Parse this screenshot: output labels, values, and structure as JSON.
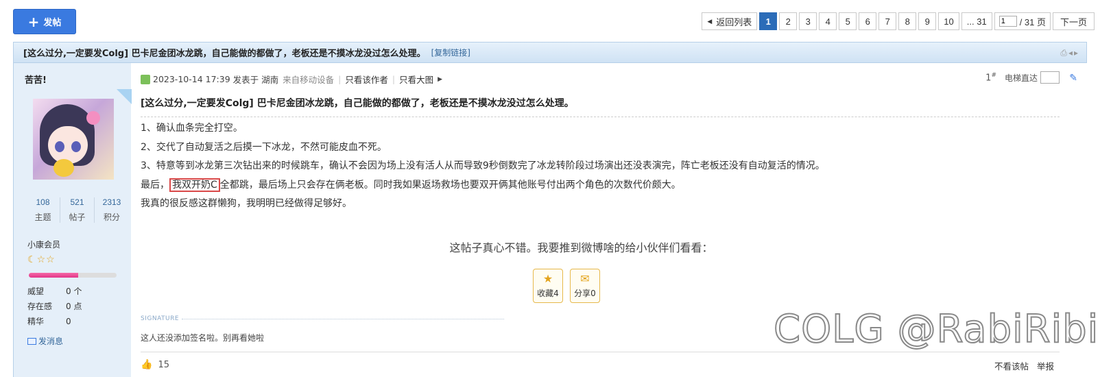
{
  "top_bar": {
    "post_button": "发帖",
    "pager": {
      "back": "返回列表",
      "pages": [
        "1",
        "2",
        "3",
        "4",
        "5",
        "6",
        "7",
        "8",
        "9",
        "10"
      ],
      "last": "... 31",
      "jump_value": "1",
      "jump_total": "/ 31 页",
      "next": "下一页"
    }
  },
  "thread": {
    "title": "[这么过分,一定要发Colg] 巴卡尼金团冰龙跳，自己能做的都做了，老板还是不摸冰龙没过怎么处理。",
    "copy_link": "[复制链接]"
  },
  "user": {
    "name": "苦苦!",
    "stats": [
      {
        "num": "108",
        "label": "主题"
      },
      {
        "num": "521",
        "label": "帖子"
      },
      {
        "num": "2313",
        "label": "积分"
      }
    ],
    "rank": "小康会员",
    "level_progress": 0.56,
    "props": [
      {
        "k": "威望",
        "v": "0 个"
      },
      {
        "k": "存在感",
        "v": "0 点"
      },
      {
        "k": "精华",
        "v": "0"
      }
    ],
    "send_message": "发消息"
  },
  "post": {
    "date": "2023-10-14 17:39",
    "posted_in": "发表于 湖南",
    "device": "来自移动设备",
    "only_author": "只看该作者",
    "only_big": "只看大图",
    "floor": "1",
    "floor_mark": "#",
    "elevator": "电梯直达",
    "title": "[这么过分,一定要发Colg] 巴卡尼金团冰龙跳，自己能做的都做了，老板还是不摸冰龙没过怎么处理。",
    "line1": "1、确认血条完全打空。",
    "line2": "2、交代了自动复活之后摸一下冰龙，不然可能皮血不死。",
    "line3": "3、特意等到冰龙第三次钻出来的时候跳车，确认不会因为场上没有活人从而导致9秒倒数完了冰龙转阶段过场演出还没表演完，阵亡老板还没有自动复活的情况。",
    "line4_pre": "最后，",
    "line4_hl": "我双开奶C",
    "line4_post": "全都跳，最后场上只会存在俩老板。同时我如果返场救场也要双开俩其他账号付出两个角色的次数代价颇大。",
    "line5": "我真的很反感这群懒狗，我明明已经做得足够好。",
    "share_prompt": "这帖子真心不错。我要推到微博啥的给小伙伴们看看：",
    "favorite": "收藏4",
    "share": "分享0",
    "signature_label": "SIGNATURE",
    "signature": "这人还没添加签名啦。别再看她啦",
    "likes": "15",
    "hide_post": "不看该帖",
    "report": "举报"
  },
  "watermark": "COLG @RabiRibi"
}
